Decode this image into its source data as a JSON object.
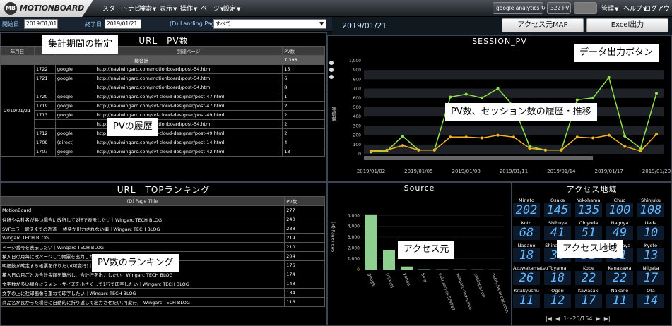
{
  "app": {
    "logo_mark": "MB",
    "logo_text": "MOTIONBOARD"
  },
  "menu": [
    {
      "label": "スタートナビ"
    },
    {
      "label": "検索"
    },
    {
      "label": "表示"
    },
    {
      "label": "操作"
    },
    {
      "label": "ページ"
    },
    {
      "label": "設定"
    }
  ],
  "topright": {
    "ga": "google analytics",
    "pv": "322 PV",
    "mgmt": "管理",
    "help": "ヘルプ",
    "logout": "ログアウト"
  },
  "filter": {
    "start_label": "開始日",
    "start_value": "2019/01/01",
    "end_label": "終了日",
    "end_value": "2019/01/21",
    "landing_label": "(D) Landing Page",
    "landing_value": "すべて"
  },
  "current_date": "2019/01/21",
  "buttons": {
    "map": "アクセス元MAP",
    "excel": "Excel出力"
  },
  "url_pv": {
    "title": "URL　PV数",
    "headers": [
      "年月日",
      "時",
      "",
      "到達ページ",
      "PV数"
    ],
    "total_label": "総合計",
    "total_value": "7,398",
    "date": "2019/01/21",
    "rows": [
      {
        "time": "1722",
        "src": "google",
        "url": "http://naviwingarc.com/motionboard/post-54.html",
        "pv": "15"
      },
      {
        "time": "1721",
        "src": "google",
        "url": "http://naviwingarc.com/motionboard/post-54.html",
        "pv": "6"
      },
      {
        "time": "",
        "src": "",
        "url": "http://naviwingarc.com/motionboard/post-54.html",
        "pv": "8"
      },
      {
        "time": "1720",
        "src": "google",
        "url": "http://naviwingarc.com/svf-cloud-designer/post-47.html",
        "pv": "1"
      },
      {
        "time": "1719",
        "src": "google",
        "url": "http://naviwingarc.com/svf-cloud-designer/post-47.html",
        "pv": "2"
      },
      {
        "time": "1713",
        "src": "google",
        "url": "http://naviwingarc.com/svf-cloud-designer/post-49.html",
        "pv": "2"
      },
      {
        "time": "",
        "src": "",
        "url": "http://naviwingarc.com/motionboard/post-54.html",
        "pv": "2"
      },
      {
        "time": "1712",
        "src": "google",
        "url": "http://naviwingarc.com/svf-cloud-designer/post-49.html",
        "pv": "2"
      },
      {
        "time": "1709",
        "src": "(direct)",
        "url": "http://naviwingarc.com/svf-cloud-designer/post-14.html",
        "pv": "4"
      },
      {
        "time": "1707",
        "src": "google",
        "url": "http://naviwingarc.com/svf-cloud-designer/post-42.html",
        "pv": "13"
      }
    ]
  },
  "ranking": {
    "title": "URL　TOPランキング",
    "headers": [
      "(D) Page Title",
      "PV数"
    ],
    "rows": [
      {
        "title": "MotionBoard",
        "pv": "277"
      },
      {
        "title": "住所や会社名が長い場合に改行して2行で表示したい｜Wingarc TECH BLOG",
        "pv": "240"
      },
      {
        "title": "SVFエラー解決までの近道 －帳票が出力されない編｜Wingarc TECH BLOG",
        "pv": "238"
      },
      {
        "title": "Wingarc TECH BLOG",
        "pv": "219"
      },
      {
        "title": "ページ番号を表示したい｜Wingarc TECH BLOG",
        "pv": "210"
      },
      {
        "title": "積入日の月毎に改ページして帳票を出力したい｜Wingarc TECH BLOG",
        "pv": "204"
      },
      {
        "title": "明細数が確定する帳票を作りたい(可変行)｜Wingarc TECH BLOG",
        "pv": "176"
      },
      {
        "title": "積入日の月ごとの合計金額を算出し、合計行を出力したい｜Wingarc TECH BLOG",
        "pv": "174"
      },
      {
        "title": "文字数が多い場合にフォントサイズを小さくして1行で印字したい｜Wingarc TECH BLOG",
        "pv": "148"
      },
      {
        "title": "文字の上に社印画像を重ねて印字したい｜Wingarc TECH BLOG",
        "pv": "134"
      },
      {
        "title": "商品名が長かった場合に自動的に折り返して出力させたい(可変行)｜Wingarc TECH BLOG",
        "pv": "116"
      }
    ]
  },
  "session_chart": {
    "title": "SESSION_PV",
    "ylabel": "実績軸"
  },
  "source_chart": {
    "title": "Source",
    "ylabel": "(M) Pageviews"
  },
  "region": {
    "title": "アクセス地域",
    "items": [
      {
        "name": "Minato",
        "value": "202"
      },
      {
        "name": "Osaka",
        "value": "145"
      },
      {
        "name": "Yokohama",
        "value": "135"
      },
      {
        "name": "Chuo",
        "value": "100"
      },
      {
        "name": "Shinjuku",
        "value": "108"
      },
      {
        "name": "Koto",
        "value": "68"
      },
      {
        "name": "Shibuya",
        "value": "41"
      },
      {
        "name": "Chiyoda",
        "value": "51"
      },
      {
        "name": "Nagoya",
        "value": "49"
      },
      {
        "name": "Ueda",
        "value": "10"
      },
      {
        "name": "Nagano",
        "value": "18"
      },
      {
        "name": "Shinagawa",
        "value": "30"
      },
      {
        "name": "Sapporo",
        "value": "31"
      },
      {
        "name": "Setagaya",
        "value": "31"
      },
      {
        "name": "Kyoto",
        "value": "13"
      },
      {
        "name": "Azuwakamatsu",
        "value": "26"
      },
      {
        "name": "Toyama",
        "value": "18"
      },
      {
        "name": "Kobe",
        "value": "22"
      },
      {
        "name": "Kanazawa",
        "value": "22"
      },
      {
        "name": "Niigata",
        "value": "17"
      },
      {
        "name": "Kitakyushu",
        "value": "11"
      },
      {
        "name": "Ogori",
        "value": "12"
      },
      {
        "name": "Kawasaki",
        "value": "17"
      },
      {
        "name": "Nakano",
        "value": "11"
      },
      {
        "name": "Ota",
        "value": "14"
      }
    ],
    "pager": "1～25/154"
  },
  "callouts": {
    "period": "集計期間の指定",
    "export": "データ出力ボタン",
    "pv_history": "PVの履歴",
    "trend": "PV数、セッション数の履歴・推移",
    "ranking": "PV数のランキング",
    "source": "アクセス元",
    "region": "アクセス地域"
  },
  "chart_data": [
    {
      "type": "line",
      "title": "SESSION_PV",
      "ylabel": "実績軸",
      "x": [
        "2019/01/02",
        "2019/01/03",
        "2019/01/04",
        "2019/01/05",
        "2019/01/06",
        "2019/01/07",
        "2019/01/08",
        "2019/01/09",
        "2019/01/10",
        "2019/01/11",
        "2019/01/12",
        "2019/01/13",
        "2019/01/14",
        "2019/01/15",
        "2019/01/16",
        "2019/01/17",
        "2019/01/18",
        "2019/01/19",
        "2019/01/20"
      ],
      "xticks": [
        "2019/01/02",
        "2019/01/05",
        "2019/01/08",
        "2019/01/11",
        "2019/01/14",
        "2019/01/17",
        "2019/01/20"
      ],
      "yticks": [
        "0",
        "100",
        "200",
        "300",
        "400",
        "500",
        "600",
        "700",
        "800",
        "900",
        "1,000"
      ],
      "ylim": [
        0,
        1000
      ],
      "series": [
        {
          "color": "#8fe04a",
          "values": [
            20,
            30,
            190,
            40,
            40,
            610,
            640,
            600,
            700,
            510,
            80,
            40,
            40,
            580,
            600,
            820,
            190,
            60,
            650
          ]
        },
        {
          "color": "#f2b324",
          "values": [
            30,
            40,
            90,
            40,
            40,
            180,
            180,
            170,
            200,
            180,
            60,
            40,
            40,
            180,
            170,
            200,
            80,
            30,
            210
          ]
        }
      ]
    },
    {
      "type": "bar",
      "title": "Source",
      "ylabel": "(M) Pageviews",
      "categories": [
        "google",
        "(direct)",
        "yahoo",
        "bing",
        "sakurachin-5/9787",
        "wingarc-news.info",
        "cnblogs.com",
        "notify.bluecoat.com"
      ],
      "values": [
        5100,
        1800,
        280,
        30,
        20,
        20,
        15,
        10
      ],
      "yticks": [
        "0",
        "1,000",
        "2,000",
        "3,000",
        "4,000",
        "5,000"
      ],
      "ylim": [
        0,
        6000
      ]
    }
  ]
}
